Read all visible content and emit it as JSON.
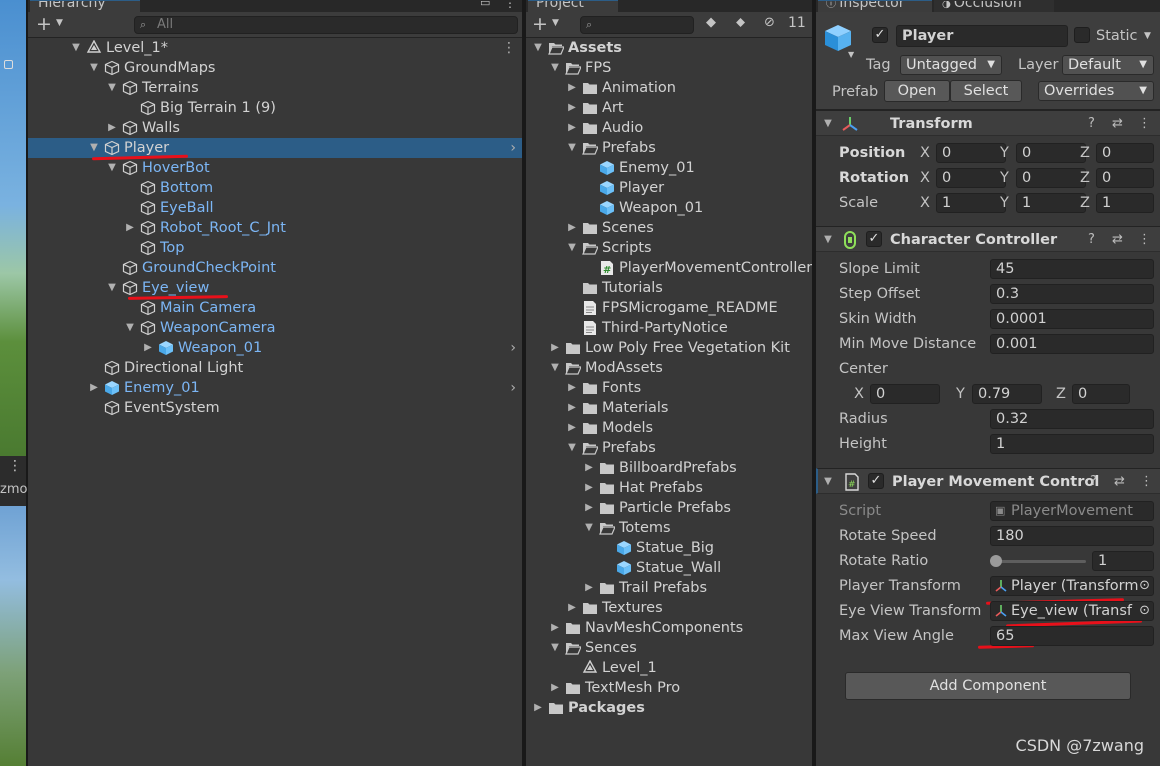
{
  "hierarchy": {
    "tab": "Hierarchy",
    "search_placeholder": "All",
    "rows": [
      {
        "label": "Level_1*",
        "kind": "scene",
        "depth": 0,
        "expanded": true
      },
      {
        "label": "GroundMaps",
        "kind": "object",
        "depth": 1,
        "expanded": true
      },
      {
        "label": "Terrains",
        "kind": "object",
        "depth": 2,
        "expanded": true
      },
      {
        "label": "Big Terrain 1 (9)",
        "kind": "object",
        "depth": 3
      },
      {
        "label": "Walls",
        "kind": "object",
        "depth": 2,
        "expanded": false
      },
      {
        "label": "Player",
        "kind": "object",
        "depth": 1,
        "expanded": true,
        "selected": true,
        "chevron": true
      },
      {
        "label": "HoverBot",
        "kind": "object-blue",
        "depth": 2,
        "expanded": true
      },
      {
        "label": "Bottom",
        "kind": "object-blue",
        "depth": 3
      },
      {
        "label": "EyeBall",
        "kind": "object-blue",
        "depth": 3
      },
      {
        "label": "Robot_Root_C_Jnt",
        "kind": "object-blue",
        "depth": 3,
        "expanded": false
      },
      {
        "label": "Top",
        "kind": "object-blue",
        "depth": 3
      },
      {
        "label": "GroundCheckPoint",
        "kind": "object-blue",
        "depth": 2
      },
      {
        "label": "Eye_view",
        "kind": "object-blue",
        "depth": 2,
        "expanded": true
      },
      {
        "label": "Main Camera",
        "kind": "object-blue",
        "depth": 3
      },
      {
        "label": "WeaponCamera",
        "kind": "object-blue",
        "depth": 3,
        "expanded": true
      },
      {
        "label": "Weapon_01",
        "kind": "prefab",
        "depth": 4,
        "expanded": false,
        "chevron": true
      },
      {
        "label": "Directional Light",
        "kind": "object",
        "depth": 1
      },
      {
        "label": "Enemy_01",
        "kind": "prefab",
        "depth": 1,
        "expanded": false,
        "chevron": true
      },
      {
        "label": "EventSystem",
        "kind": "object",
        "depth": 1
      }
    ]
  },
  "scene_view": {
    "label": "zmo"
  },
  "project": {
    "tab": "Project",
    "hidden_count": "11",
    "rows": [
      {
        "label": "Assets",
        "kind": "folder-open",
        "depth": 0,
        "expanded": true,
        "bold": true
      },
      {
        "label": "FPS",
        "kind": "folder-open",
        "depth": 1,
        "expanded": true
      },
      {
        "label": "Animation",
        "kind": "folder",
        "depth": 2,
        "expanded": false
      },
      {
        "label": "Art",
        "kind": "folder",
        "depth": 2,
        "expanded": false
      },
      {
        "label": "Audio",
        "kind": "folder",
        "depth": 2,
        "expanded": false
      },
      {
        "label": "Prefabs",
        "kind": "folder-open",
        "depth": 2,
        "expanded": true
      },
      {
        "label": "Enemy_01",
        "kind": "prefab",
        "depth": 3
      },
      {
        "label": "Player",
        "kind": "prefab",
        "depth": 3
      },
      {
        "label": "Weapon_01",
        "kind": "prefab",
        "depth": 3
      },
      {
        "label": "Scenes",
        "kind": "folder",
        "depth": 2,
        "expanded": false
      },
      {
        "label": "Scripts",
        "kind": "folder-open",
        "depth": 2,
        "expanded": true
      },
      {
        "label": "PlayerMovementController",
        "kind": "script",
        "depth": 3
      },
      {
        "label": "Tutorials",
        "kind": "folder",
        "depth": 2
      },
      {
        "label": "FPSMicrogame_README",
        "kind": "doc",
        "depth": 2
      },
      {
        "label": "Third-PartyNotice",
        "kind": "doc",
        "depth": 2
      },
      {
        "label": "Low Poly Free Vegetation Kit",
        "kind": "folder",
        "depth": 1,
        "expanded": false
      },
      {
        "label": "ModAssets",
        "kind": "folder-open",
        "depth": 1,
        "expanded": true
      },
      {
        "label": "Fonts",
        "kind": "folder",
        "depth": 2,
        "expanded": false
      },
      {
        "label": "Materials",
        "kind": "folder",
        "depth": 2,
        "expanded": false
      },
      {
        "label": "Models",
        "kind": "folder",
        "depth": 2,
        "expanded": false
      },
      {
        "label": "Prefabs",
        "kind": "folder-open",
        "depth": 2,
        "expanded": true
      },
      {
        "label": "BillboardPrefabs",
        "kind": "folder",
        "depth": 3,
        "expanded": false
      },
      {
        "label": "Hat Prefabs",
        "kind": "folder",
        "depth": 3,
        "expanded": false
      },
      {
        "label": "Particle Prefabs",
        "kind": "folder",
        "depth": 3,
        "expanded": false
      },
      {
        "label": "Totems",
        "kind": "folder-open",
        "depth": 3,
        "expanded": true
      },
      {
        "label": "Statue_Big",
        "kind": "prefab",
        "depth": 4
      },
      {
        "label": "Statue_Wall",
        "kind": "prefab",
        "depth": 4
      },
      {
        "label": "Trail Prefabs",
        "kind": "folder",
        "depth": 3,
        "expanded": false
      },
      {
        "label": "Textures",
        "kind": "folder",
        "depth": 2,
        "expanded": false
      },
      {
        "label": "NavMeshComponents",
        "kind": "folder",
        "depth": 1,
        "expanded": false
      },
      {
        "label": "Sences",
        "kind": "folder-open",
        "depth": 1,
        "expanded": true
      },
      {
        "label": "Level_1",
        "kind": "scene",
        "depth": 2
      },
      {
        "label": "TextMesh Pro",
        "kind": "folder",
        "depth": 1,
        "expanded": false
      },
      {
        "label": "Packages",
        "kind": "folder",
        "depth": 0,
        "expanded": false,
        "bold": true
      }
    ]
  },
  "inspector": {
    "tab": "Inspector",
    "tab2": "Occlusion",
    "object_name": "Player",
    "static_label": "Static",
    "tag_label": "Tag",
    "tag_value": "Untagged",
    "layer_label": "Layer",
    "layer_value": "Default",
    "prefab_label": "Prefab",
    "open_label": "Open",
    "select_label": "Select",
    "overrides_label": "Overrides",
    "transform": {
      "title": "Transform",
      "position_label": "Position",
      "rotation_label": "Rotation",
      "scale_label": "Scale",
      "position": [
        "0",
        "0",
        "0"
      ],
      "rotation": [
        "0",
        "0",
        "0"
      ],
      "scale": [
        "1",
        "1",
        "1"
      ]
    },
    "character_controller": {
      "title": "Character Controller",
      "slope_limit_label": "Slope Limit",
      "slope_limit": "45",
      "step_offset_label": "Step Offset",
      "step_offset": "0.3",
      "skin_width_label": "Skin Width",
      "skin_width": "0.0001",
      "min_move_label": "Min Move Distance",
      "min_move": "0.001",
      "center_label": "Center",
      "center": [
        "0",
        "0.79",
        "0"
      ],
      "radius_label": "Radius",
      "radius": "0.32",
      "height_label": "Height",
      "height": "1"
    },
    "player_movement": {
      "title": "Player Movement Control",
      "script_label": "Script",
      "script_value": "PlayerMovement",
      "rotate_speed_label": "Rotate Speed",
      "rotate_speed": "180",
      "rotate_ratio_label": "Rotate Ratio",
      "rotate_ratio": "1",
      "player_transform_label": "Player Transform",
      "player_transform": "Player (Transform",
      "eye_view_label": "Eye View Transform",
      "eye_view": "Eye_view (Transf",
      "max_view_label": "Max View Angle",
      "max_view": "65"
    },
    "add_component": "Add Component",
    "axis_x": "X",
    "axis_y": "Y",
    "axis_z": "Z"
  },
  "watermark": "CSDN @7zwang",
  "colors": {
    "selection": "#2c5d87",
    "prefab_text": "#7cb6f5",
    "annotation": "#e8101a",
    "prefab_icon": "#4aa8e8"
  }
}
